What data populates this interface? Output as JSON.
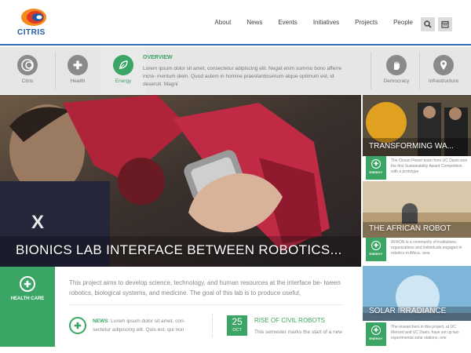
{
  "header": {
    "logo_text": "CITRIS",
    "nav": [
      "About",
      "News",
      "Events",
      "Initiatives",
      "Projects",
      "People"
    ],
    "search_icon": "search-icon",
    "calendar_icon": "calendar-icon"
  },
  "topics": [
    {
      "label": "Citris",
      "icon": "citris-logo-icon"
    },
    {
      "label": "Health",
      "icon": "health-plus-icon"
    },
    {
      "label": "Energy",
      "icon": "leaf-icon"
    },
    {
      "label": "Democracy",
      "icon": "hand-icon"
    },
    {
      "label": "Infrastructure",
      "icon": "location-pin-icon"
    }
  ],
  "overview": {
    "title": "OVERVIEW",
    "text": "Lorem ipsum dolor sit amet, consectetur adipiscing elit. Negat enim summo bono afferre incre- mentum diem. Quod autem in homine praestantissimum atque optimum est, id deseruit. Magni"
  },
  "hero": {
    "title": "BIONICS LAB INTERFACE BETWEEN ROBOTICS..."
  },
  "category": {
    "label": "HEALTH CARE"
  },
  "description": "This project aims to develop science, technology, and human resources at the interface be- tween robotics, biological systems, and medicine. The goal of this lab is to produce useful,",
  "news": {
    "label": "NEWS",
    "text": ": Lorem ipsum dolor sit amet, con- sectetur adipiscing elit. Quis est, qui non"
  },
  "event": {
    "day": "25",
    "month": "OCT",
    "title": "RISE OF CIVIL ROBOTS",
    "text": "This semester marks the start of a new"
  },
  "side_cards": [
    {
      "title": "TRANSFORMING WA...",
      "tag": "ENERGY",
      "text": "The Ocean Power team from UC Davis won the first Sustainability Award Competition with a prototype"
    },
    {
      "title": "THE AFRICAN ROBOT",
      "tag": "ENERGY",
      "text": "AFRON is a community of institutions, organizations and individuals engaged in robotics in Africa. view"
    },
    {
      "title": "SOLAR IRRADIANCE",
      "tag": "ENERGY",
      "text": "The researchers in this project, at UC Merced and UC Davis, have set up two experimental solar stations, one"
    }
  ],
  "colors": {
    "accent_green": "#3aa564",
    "brand_blue": "#1f5aa6",
    "logo_orange": "#f28a1e"
  }
}
